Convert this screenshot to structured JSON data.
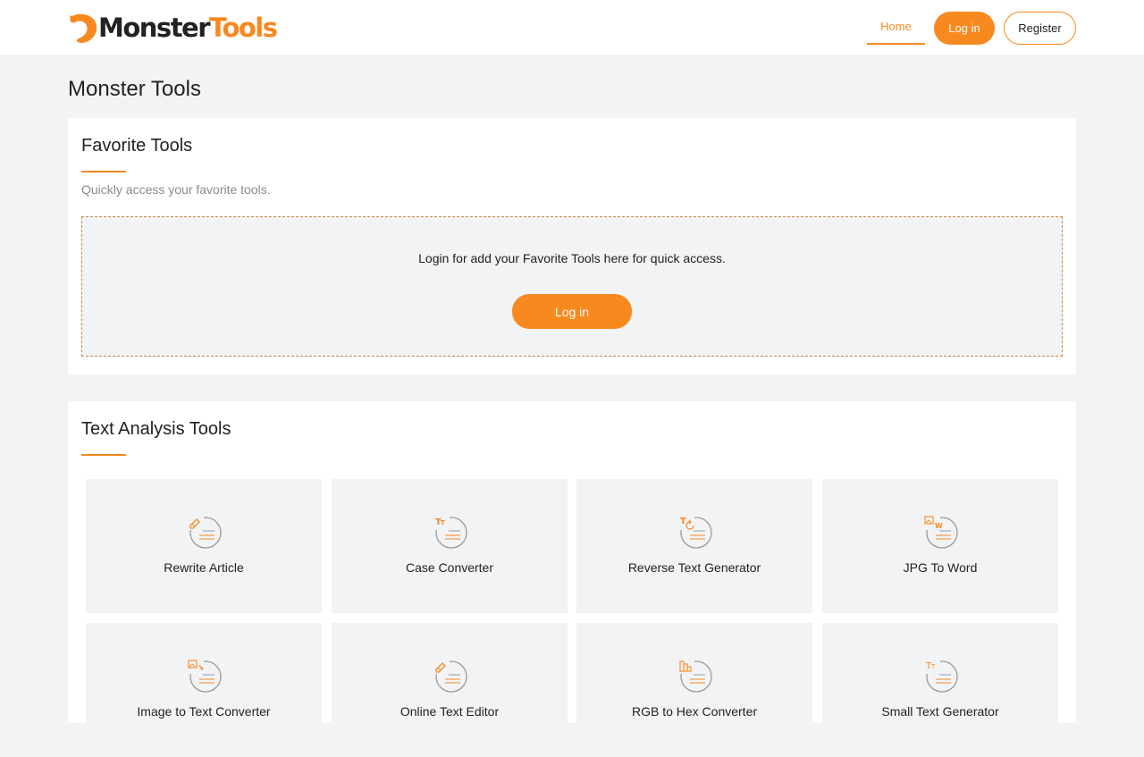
{
  "header": {
    "logo_part1": "Monster",
    "logo_part2": "Tools",
    "nav_home": "Home",
    "nav_login": "Log in",
    "nav_register": "Register"
  },
  "page_title": "Monster Tools",
  "favorites": {
    "title": "Favorite Tools",
    "subtitle": "Quickly access your favorite tools.",
    "message": "Login for add your Favorite Tools here for quick access.",
    "login_button": "Log in"
  },
  "text_analysis": {
    "title": "Text Analysis Tools",
    "tools": [
      {
        "label": "Rewrite Article",
        "icon": "pencil-doc-icon"
      },
      {
        "label": "Case Converter",
        "icon": "case-tt-doc-icon"
      },
      {
        "label": "Reverse Text Generator",
        "icon": "reverse-text-doc-icon"
      },
      {
        "label": "JPG To Word",
        "icon": "image-word-doc-icon"
      },
      {
        "label": "Image to Text Converter",
        "icon": "image-arrow-doc-icon"
      },
      {
        "label": "Online Text Editor",
        "icon": "pencil-doc-icon"
      },
      {
        "label": "RGB to Hex Converter",
        "icon": "palette-doc-icon"
      },
      {
        "label": "Small Text Generator",
        "icon": "small-tt-doc-icon"
      }
    ]
  },
  "colors": {
    "accent": "#f7891e",
    "background": "#f2f3f5"
  }
}
